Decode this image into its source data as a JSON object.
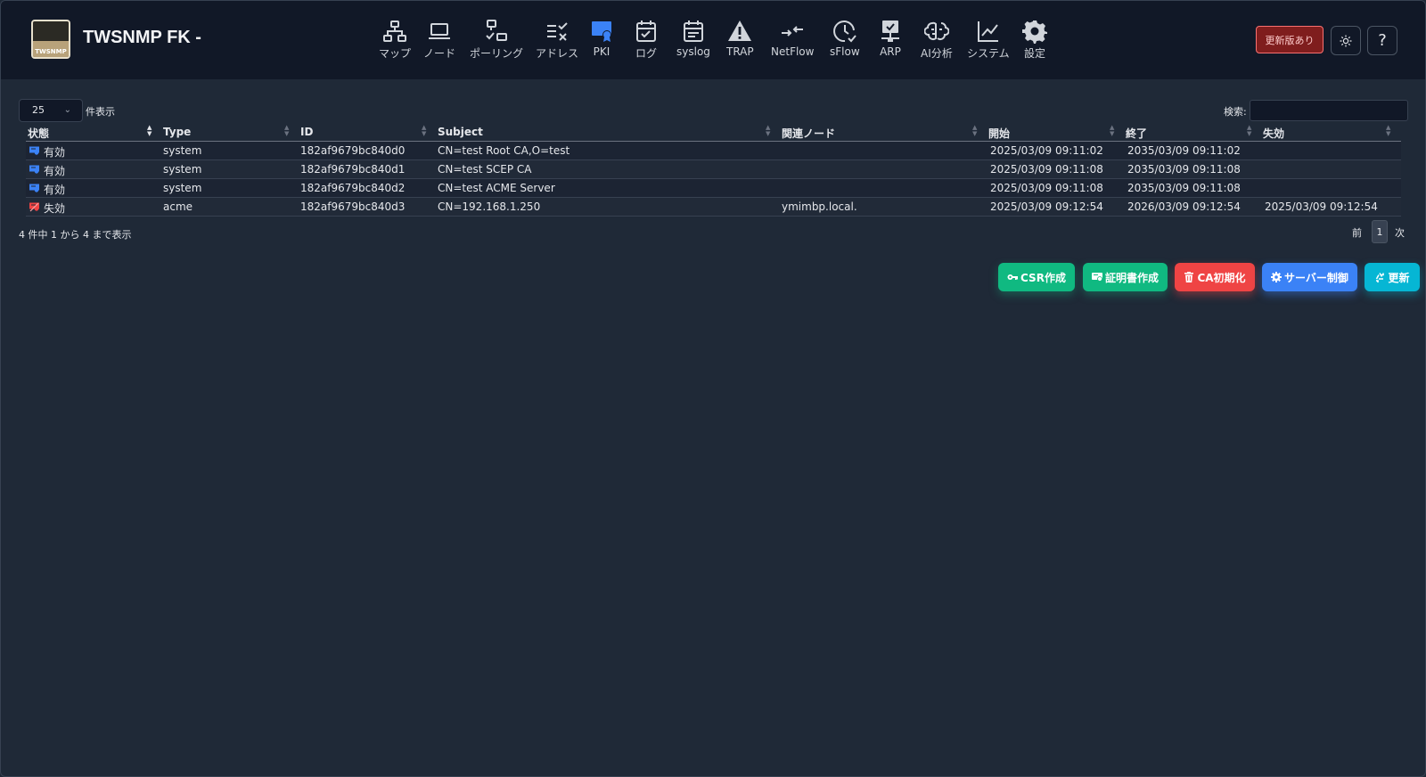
{
  "app": {
    "title": "TWSNMP FK -",
    "logo_text": "TWSNMP"
  },
  "nav": {
    "items": [
      {
        "label": "マップ",
        "icon": "sitemap-icon"
      },
      {
        "label": "ノード",
        "icon": "laptop-icon"
      },
      {
        "label": "ポーリング",
        "icon": "polling-icon"
      },
      {
        "label": "アドレス",
        "icon": "address-check-icon"
      },
      {
        "label": "PKI",
        "icon": "certificate-icon",
        "active": true
      },
      {
        "label": "ログ",
        "icon": "calendar-check-icon"
      },
      {
        "label": "syslog",
        "icon": "calendar-list-icon"
      },
      {
        "label": "TRAP",
        "icon": "warning-icon"
      },
      {
        "label": "NetFlow",
        "icon": "arrows-icon"
      },
      {
        "label": "sFlow",
        "icon": "clock-check-icon"
      },
      {
        "label": "ARP",
        "icon": "network-monitor-icon"
      },
      {
        "label": "AI分析",
        "icon": "brain-icon"
      },
      {
        "label": "システム",
        "icon": "line-chart-icon"
      },
      {
        "label": "設定",
        "icon": "gear-icon"
      }
    ]
  },
  "header_actions": {
    "update_available": "更新版あり",
    "theme_icon": "sun-icon",
    "help": "?"
  },
  "controls": {
    "page_size": "25",
    "page_size_suffix": "件表示",
    "search_label": "検索:",
    "search_value": ""
  },
  "table": {
    "columns": [
      "状態",
      "Type",
      "ID",
      "Subject",
      "関連ノード",
      "開始",
      "終了",
      "失効"
    ],
    "rows": [
      {
        "status": "有効",
        "status_icon": "certificate-valid-icon",
        "type": "system",
        "id": "182af9679bc840d0",
        "subject": "CN=test Root CA,O=test",
        "node": "",
        "start": "2025/03/09 09:11:02",
        "end": "2035/03/09 09:11:02",
        "revoked": ""
      },
      {
        "status": "有効",
        "status_icon": "certificate-valid-icon",
        "type": "system",
        "id": "182af9679bc840d1",
        "subject": "CN=test SCEP CA",
        "node": "",
        "start": "2025/03/09 09:11:08",
        "end": "2035/03/09 09:11:08",
        "revoked": ""
      },
      {
        "status": "有効",
        "status_icon": "certificate-valid-icon",
        "type": "system",
        "id": "182af9679bc840d2",
        "subject": "CN=test ACME Server",
        "node": "",
        "start": "2025/03/09 09:11:08",
        "end": "2035/03/09 09:11:08",
        "revoked": ""
      },
      {
        "status": "失効",
        "status_icon": "certificate-revoked-icon",
        "type": "acme",
        "id": "182af9679bc840d3",
        "subject": "CN=192.168.1.250",
        "node": "ymimbp.local.",
        "start": "2025/03/09 09:12:54",
        "end": "2026/03/09 09:12:54",
        "revoked": "2025/03/09 09:12:54"
      }
    ]
  },
  "footer": {
    "info": "4 件中 1 から 4 まで表示",
    "prev": "前",
    "page": "1",
    "next": "次"
  },
  "actions": {
    "csr": "CSR作成",
    "cert": "証明書作成",
    "ca_init": "CA初期化",
    "server": "サーバー制御",
    "refresh": "更新"
  },
  "colors": {
    "valid": "#3b82f6",
    "revoked": "#ef4444",
    "accent": "#3b82f6"
  }
}
